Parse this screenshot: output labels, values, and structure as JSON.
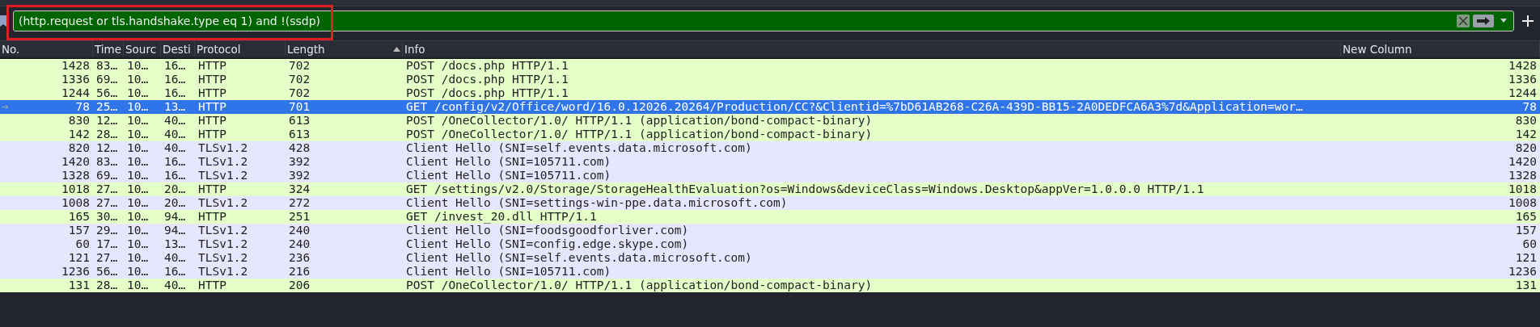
{
  "filter": {
    "value": "(http.request or tls.handshake.type eq 1) and !(ssdp)",
    "valid": true,
    "annotated": true
  },
  "columns": [
    {
      "label": "No."
    },
    {
      "label": "Time"
    },
    {
      "label": "Sourc"
    },
    {
      "label": "Desti"
    },
    {
      "label": "Protocol"
    },
    {
      "label": "Length",
      "sorted": true
    },
    {
      "label": "Info"
    },
    {
      "label": "New Column"
    }
  ],
  "rows": [
    {
      "kind": "http",
      "selected": false,
      "cells": [
        "1428",
        "83…",
        "10…",
        "16…",
        "HTTP",
        "702",
        "POST /docs.php HTTP/1.1",
        "1428"
      ]
    },
    {
      "kind": "http",
      "selected": false,
      "cells": [
        "1336",
        "69…",
        "10…",
        "16…",
        "HTTP",
        "702",
        "POST /docs.php HTTP/1.1",
        "1336"
      ]
    },
    {
      "kind": "http",
      "selected": false,
      "cells": [
        "1244",
        "56…",
        "10…",
        "16…",
        "HTTP",
        "702",
        "POST /docs.php HTTP/1.1",
        "1244"
      ]
    },
    {
      "kind": "http",
      "selected": true,
      "cells": [
        "78",
        "25…",
        "10…",
        "13…",
        "HTTP",
        "701",
        "GET /config/v2/Office/word/16.0.12026.20264/Production/CC?&Clientid=%7bD61AB268-C26A-439D-BB15-2A0DEDFCA6A3%7d&Application=wor…",
        "78"
      ]
    },
    {
      "kind": "http",
      "selected": false,
      "cells": [
        "830",
        "12…",
        "10…",
        "40…",
        "HTTP",
        "613",
        "POST /OneCollector/1.0/ HTTP/1.1  (application/bond-compact-binary)",
        "830"
      ]
    },
    {
      "kind": "http",
      "selected": false,
      "cells": [
        "142",
        "28…",
        "10…",
        "40…",
        "HTTP",
        "613",
        "POST /OneCollector/1.0/ HTTP/1.1  (application/bond-compact-binary)",
        "142"
      ]
    },
    {
      "kind": "tls",
      "selected": false,
      "cells": [
        "820",
        "12…",
        "10…",
        "40…",
        "TLSv1.2",
        "428",
        "Client Hello (SNI=self.events.data.microsoft.com)",
        "820"
      ]
    },
    {
      "kind": "tls",
      "selected": false,
      "cells": [
        "1420",
        "83…",
        "10…",
        "16…",
        "TLSv1.2",
        "392",
        "Client Hello (SNI=105711.com)",
        "1420"
      ]
    },
    {
      "kind": "tls",
      "selected": false,
      "cells": [
        "1328",
        "69…",
        "10…",
        "16…",
        "TLSv1.2",
        "392",
        "Client Hello (SNI=105711.com)",
        "1328"
      ]
    },
    {
      "kind": "http",
      "selected": false,
      "cells": [
        "1018",
        "27…",
        "10…",
        "20…",
        "HTTP",
        "324",
        "GET /settings/v2.0/Storage/StorageHealthEvaluation?os=Windows&deviceClass=Windows.Desktop&appVer=1.0.0.0 HTTP/1.1",
        "1018"
      ]
    },
    {
      "kind": "tls",
      "selected": false,
      "cells": [
        "1008",
        "27…",
        "10…",
        "20…",
        "TLSv1.2",
        "272",
        "Client Hello (SNI=settings-win-ppe.data.microsoft.com)",
        "1008"
      ]
    },
    {
      "kind": "http",
      "selected": false,
      "cells": [
        "165",
        "30…",
        "10…",
        "94…",
        "HTTP",
        "251",
        "GET /invest_20.dll HTTP/1.1",
        "165"
      ]
    },
    {
      "kind": "tls",
      "selected": false,
      "cells": [
        "157",
        "29…",
        "10…",
        "94…",
        "TLSv1.2",
        "240",
        "Client Hello (SNI=foodsgoodforliver.com)",
        "157"
      ]
    },
    {
      "kind": "tls",
      "selected": false,
      "cells": [
        "60",
        "17…",
        "10…",
        "13…",
        "TLSv1.2",
        "240",
        "Client Hello (SNI=config.edge.skype.com)",
        "60"
      ]
    },
    {
      "kind": "tls",
      "selected": false,
      "cells": [
        "121",
        "27…",
        "10…",
        "40…",
        "TLSv1.2",
        "236",
        "Client Hello (SNI=self.events.data.microsoft.com)",
        "121"
      ]
    },
    {
      "kind": "tls",
      "selected": false,
      "cells": [
        "1236",
        "56…",
        "10…",
        "16…",
        "TLSv1.2",
        "216",
        "Client Hello (SNI=105711.com)",
        "1236"
      ]
    },
    {
      "kind": "http",
      "selected": false,
      "cells": [
        "131",
        "28…",
        "10…",
        "40…",
        "HTTP",
        "206",
        "POST /OneCollector/1.0/ HTTP/1.1  (application/bond-compact-binary)",
        "131"
      ]
    }
  ]
}
